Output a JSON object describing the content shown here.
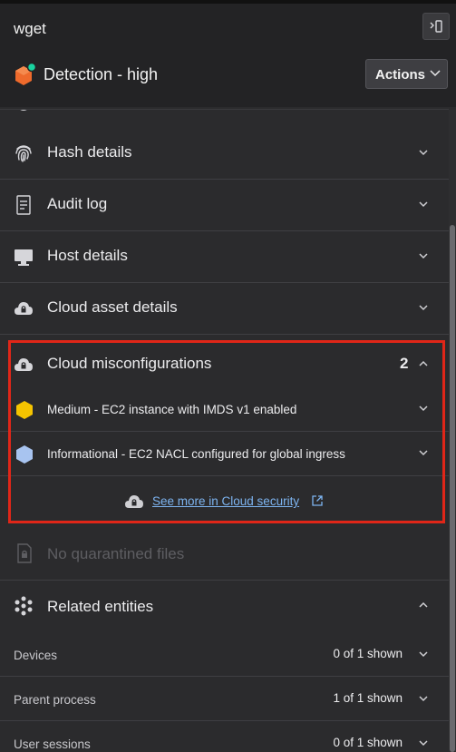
{
  "window": {
    "title": "wget"
  },
  "detection": {
    "title": "Detection - high",
    "actions_label": "Actions"
  },
  "sections": [
    {
      "label": "Hash details",
      "icon": "fingerprint-icon"
    },
    {
      "label": "Audit log",
      "icon": "document-icon"
    },
    {
      "label": "Host details",
      "icon": "monitor-icon"
    },
    {
      "label": "Cloud asset details",
      "icon": "cloud-lock-icon"
    }
  ],
  "misconfigurations": {
    "label": "Cloud misconfigurations",
    "count": "2",
    "items": [
      {
        "label": "Medium - EC2 instance with IMDS v1 enabled",
        "severity_color": "#f5c400"
      },
      {
        "label": "Informational - EC2 NACL configured for global ingress",
        "severity_color": "#a8c4f0"
      }
    ],
    "see_more": "See more in Cloud security"
  },
  "quarantine": {
    "label": "No quarantined files"
  },
  "related": {
    "label": "Related entities",
    "rows": [
      {
        "label": "Devices",
        "count": "0 of 1 shown"
      },
      {
        "label": "Parent process",
        "count": "1 of 1 shown"
      },
      {
        "label": "User sessions",
        "count": "0 of 1 shown"
      }
    ]
  },
  "colors": {
    "accent_red": "#e02618",
    "link": "#7db4f0",
    "brand_orange": "#ee6a2c",
    "status_green": "#19d3a0"
  }
}
